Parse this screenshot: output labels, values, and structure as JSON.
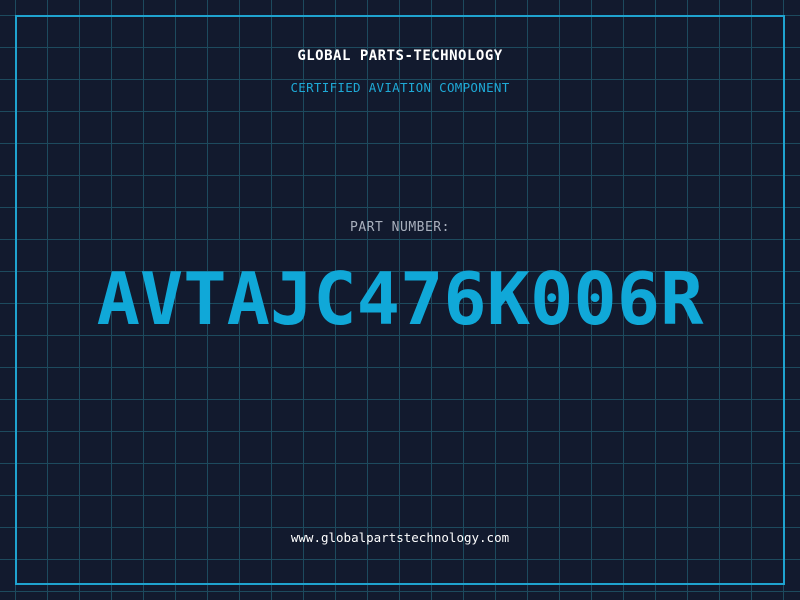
{
  "header": {
    "company": "GLOBAL PARTS-TECHNOLOGY",
    "tagline": "CERTIFIED AVIATION COMPONENT"
  },
  "part": {
    "label": "PART NUMBER:",
    "number": "AVTAJC476K006R"
  },
  "footer": {
    "website": "www.globalpartstechnology.com"
  },
  "colors": {
    "background": "#121a2e",
    "grid": "#1d4a5e",
    "accent": "#1fa3cf",
    "part_number": "#10a8d8"
  }
}
